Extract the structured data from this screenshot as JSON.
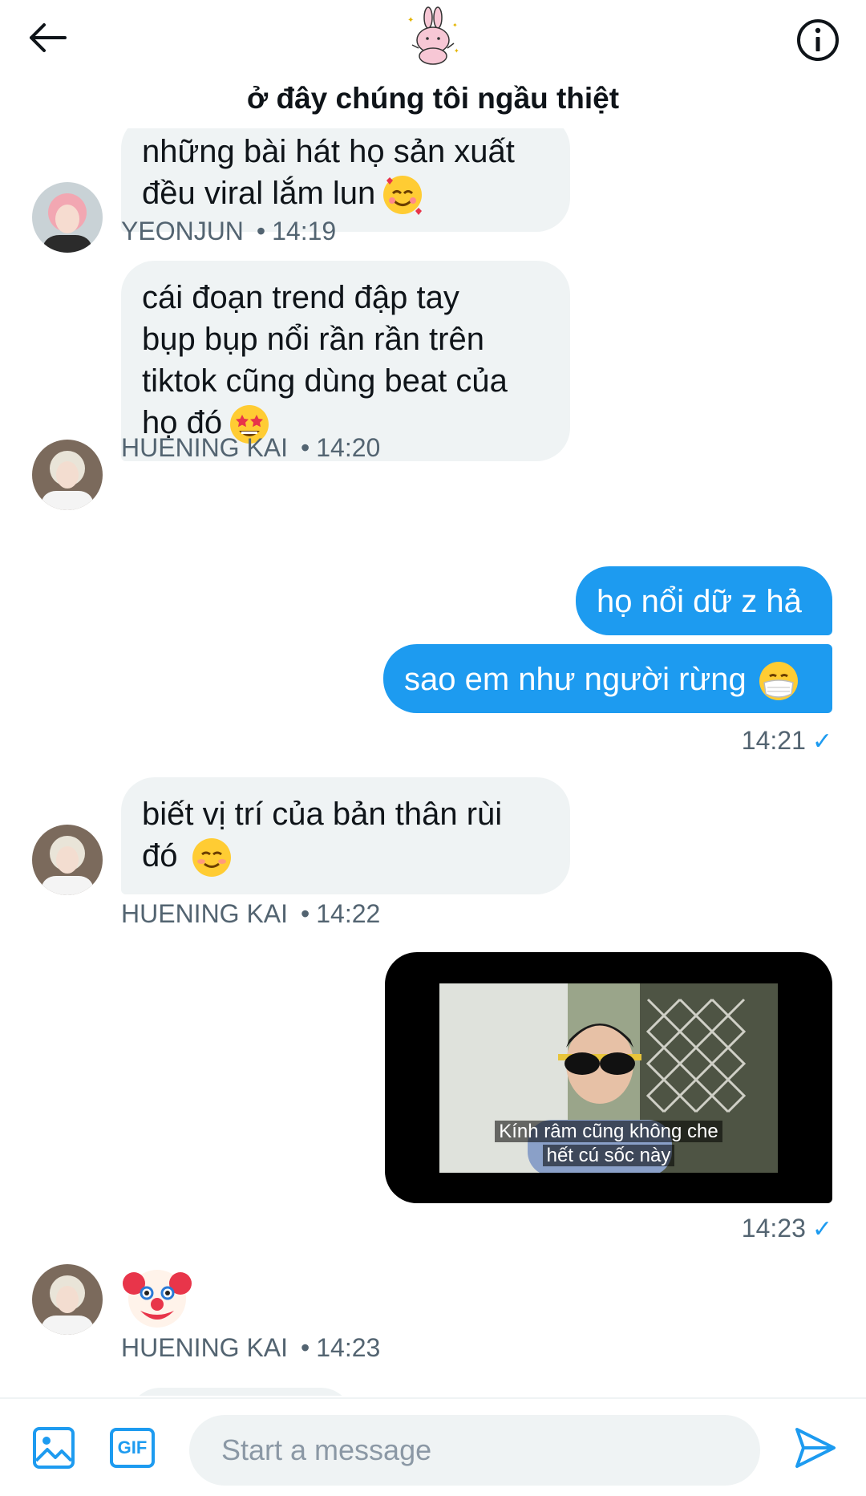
{
  "header": {
    "title": "ở đây chúng tôi ngầu thiệt",
    "back_icon": "arrow-left-icon",
    "info_icon": "info-circle-icon"
  },
  "messages": [
    {
      "direction": "in",
      "text_line1": "những bài hát họ sản xuất",
      "text_line2": "đều viral lắm lun",
      "emoji": "smiling-face-with-hearts",
      "sender": "YEONJUN",
      "time": "14:19"
    },
    {
      "direction": "in",
      "text_line1": "cái đoạn trend đập tay",
      "text_line2": "bụp bụp nổi rần rần trên",
      "text_line3": "tiktok cũng dùng beat của",
      "text_line4": "họ đó",
      "emoji": "star-struck",
      "sender": "HUENING KAI",
      "time": "14:20"
    },
    {
      "direction": "out",
      "text": "họ nổi dữ z hả"
    },
    {
      "direction": "out",
      "text": "sao em như người rừng",
      "emoji": "face-with-medical-mask",
      "time": "14:21",
      "status": "✓"
    },
    {
      "direction": "in",
      "text_line1": "biết vị trí của bản thân rùi",
      "text_line2": "đó",
      "emoji": "smiling-face",
      "sender": "HUENING KAI",
      "time": "14:22"
    },
    {
      "direction": "out",
      "type": "video",
      "subtitle_line1": "Kính râm cũng không che",
      "subtitle_line2": "hết cú sốc này",
      "time": "14:23",
      "status": "✓"
    },
    {
      "direction": "in",
      "emoji": "clown-face",
      "sender": "HUENING KAI",
      "time": "14:23"
    }
  ],
  "composer": {
    "placeholder": "Start a message",
    "gif_label": "GIF",
    "media_icon": "image-icon",
    "send_icon": "send-icon"
  },
  "colors": {
    "accent": "#1d9bf0",
    "incoming_bubble": "#eff3f4",
    "muted_text": "#536471"
  }
}
